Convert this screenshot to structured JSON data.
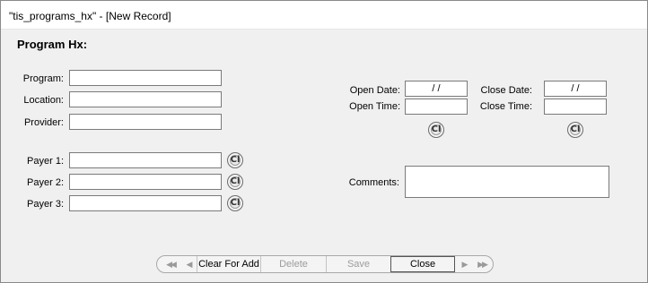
{
  "window": {
    "title": "\"tis_programs_hx\" - [New Record]"
  },
  "form": {
    "section_title": "Program Hx:",
    "program_label": "Program:",
    "location_label": "Location:",
    "provider_label": "Provider:",
    "payer1_label": "Payer 1:",
    "payer2_label": "Payer 2:",
    "payer3_label": "Payer 3:",
    "open_date_label": "Open Date:",
    "close_date_label": "Close Date:",
    "open_time_label": "Open Time:",
    "close_time_label": "Close Time:",
    "comments_label": "Comments:",
    "program_value": "",
    "location_value": "",
    "provider_value": "",
    "payer1_value": "",
    "payer2_value": "",
    "payer3_value": "",
    "open_date_value": "/ /",
    "close_date_value": "/ /",
    "open_time_value": "",
    "close_time_value": "",
    "comments_value": "",
    "clear_glyph": "Cl"
  },
  "navbar": {
    "first_glyph": "◀◀",
    "prev_glyph": "◀",
    "clear_for_add": "Clear For Add",
    "delete": "Delete",
    "save": "Save",
    "close": "Close",
    "next_glyph": "▶",
    "last_glyph": "▶▶"
  }
}
